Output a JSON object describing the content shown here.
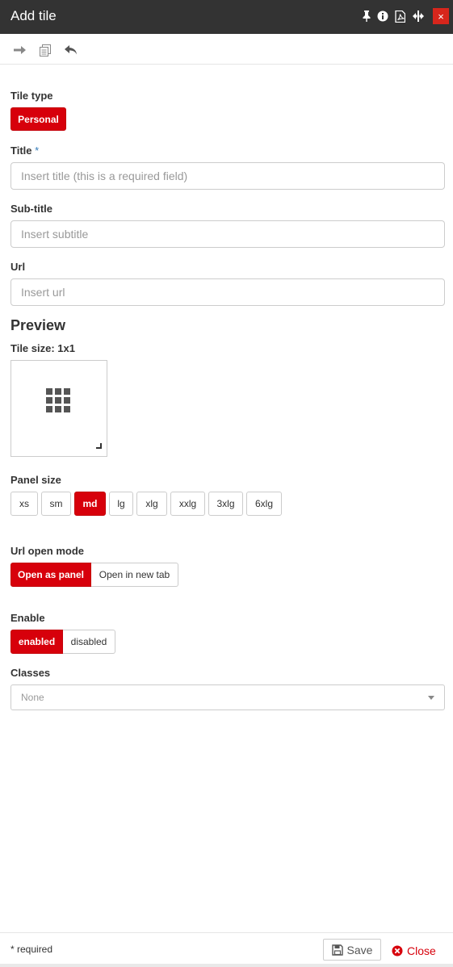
{
  "window": {
    "title": "Add tile",
    "icons": [
      "pin-icon",
      "info-icon",
      "pdf-icon",
      "resize-width-icon",
      "close-icon"
    ],
    "close_label": "×"
  },
  "toolbar": {
    "icons": [
      "forward-arrow-icon",
      "copy-icon",
      "back-arrow-icon"
    ]
  },
  "form": {
    "tile_type_label": "Tile type",
    "tile_type_value": "Personal",
    "title_label": "Title",
    "required_star": "*",
    "title_placeholder": "Insert title (this is a required field)",
    "subtitle_label": "Sub-title",
    "subtitle_placeholder": "Insert subtitle",
    "url_label": "Url",
    "url_placeholder": "Insert url"
  },
  "preview": {
    "heading": "Preview",
    "tile_size_label": "Tile size: 1x1"
  },
  "panel_size": {
    "label": "Panel size",
    "options": [
      "xs",
      "sm",
      "md",
      "lg",
      "xlg",
      "xxlg",
      "3xlg",
      "6xlg"
    ],
    "selected": "md"
  },
  "url_open_mode": {
    "label": "Url open mode",
    "options": [
      "Open as panel",
      "Open in new tab"
    ],
    "selected": "Open as panel"
  },
  "enable": {
    "label": "Enable",
    "options": [
      "enabled",
      "disabled"
    ],
    "selected": "enabled"
  },
  "classes": {
    "label": "Classes",
    "value": "None"
  },
  "footer": {
    "required_note": "* required",
    "save_label": "Save",
    "close_label": "Close"
  },
  "colors": {
    "accent": "#d7000b",
    "titlebar": "#333333",
    "required_star": "#337ab7"
  }
}
